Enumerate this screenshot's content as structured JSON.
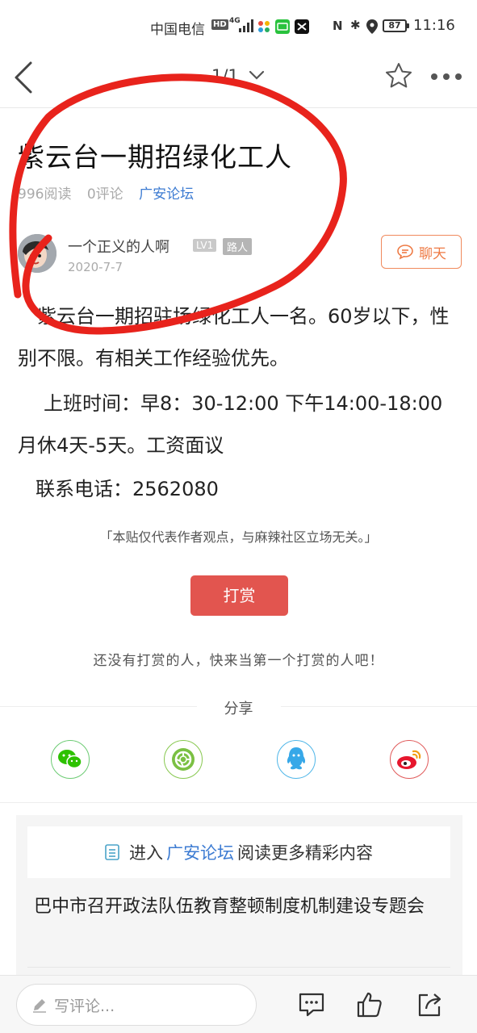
{
  "status_bar": {
    "carrier": "中国电信",
    "hd": "HD",
    "network": "4G",
    "nfc": "N",
    "battery": "87",
    "time": "11:16"
  },
  "nav": {
    "page_indicator": "1/1"
  },
  "article": {
    "title": "紫云台一期招绿化工人",
    "reads": "996阅读",
    "comments": "0评论",
    "forum": "广安论坛",
    "author": {
      "name": "一个正义的人啊",
      "level": "LV1",
      "role": "路人",
      "date": "2020-7-7"
    },
    "chat_label": "聊天",
    "paragraphs": [
      "紫云台一期招驻场绿化工人一名。60岁以下，性别不限。有相关工作经验优先。",
      "上班时间：早8：30-12:00 下午14:00-18:00 月休4天-5天。工资面议",
      "联系电话：2562080"
    ],
    "disclaimer": "「本贴仅代表作者观点，与麻辣社区立场无关。」"
  },
  "reward": {
    "button_label": "打赏",
    "note": "还没有打赏的人，快来当第一个打赏的人吧！"
  },
  "share": {
    "label": "分享",
    "targets": [
      "wechat",
      "moments",
      "qq",
      "weibo"
    ]
  },
  "more": {
    "enter_prefix": "进入",
    "forum": "广安论坛",
    "enter_suffix": "阅读更多精彩内容",
    "related": [
      "巴中市召开政法队伍教育整顿制度机制建设专题会"
    ]
  },
  "bottom_bar": {
    "comment_placeholder": "写评论..."
  },
  "colors": {
    "accent_blue": "#3c7bd2",
    "reward_red": "#e2554f",
    "chat_orange": "#ee7a44",
    "annotation_red": "#e8231c"
  }
}
